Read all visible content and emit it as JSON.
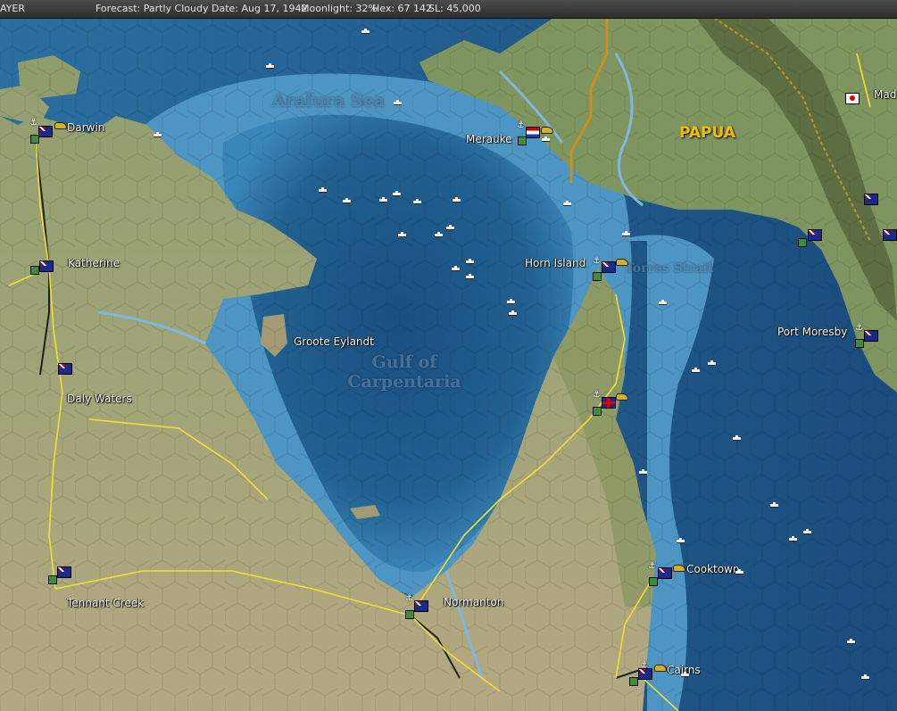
{
  "status_bar": {
    "view": "AYER",
    "forecast": "Forecast: Partly Cloudy",
    "date": "Date: Aug 17, 1942",
    "moonlight": "Moonlight: 32%",
    "hex": "Hex: 67 142",
    "sl": "SL: 45,000"
  },
  "map": {
    "seas": {
      "arafura": "Arafura Sea",
      "gulf_line1": "Gulf of",
      "gulf_line2": "Carpentaria",
      "torres": "Torres Strait"
    },
    "region": "PAPUA",
    "places": {
      "darwin": "Darwin",
      "katherine": "Katherine",
      "daly_waters": "Daly Waters",
      "tennant_creek": "Tennant Creek",
      "groote_eylandt": "Groote Eylandt",
      "normanton": "Normanton",
      "horn_island": "Horn Island",
      "merauke": "Merauke",
      "port_moresby": "Port Moresby",
      "cooktown": "Cooktown",
      "cairns": "Cairns",
      "madang": "Mad"
    },
    "nation_flags": [
      "australia",
      "netherlands",
      "united-kingdom",
      "japan"
    ],
    "colors": {
      "land": "#a9a27d",
      "shallow_water": "#5fa6cc",
      "deep_water": "#1f5a8a",
      "road": "#f0e030",
      "railway": "#202020",
      "border": "#c8901e"
    }
  }
}
